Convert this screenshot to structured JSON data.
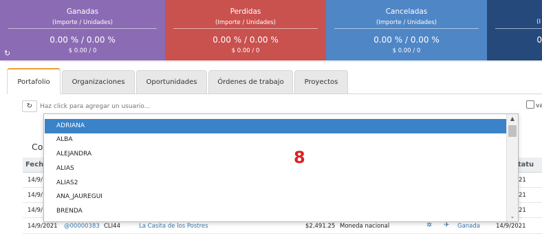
{
  "cards": [
    {
      "title": "Ganadas",
      "sub": "(Importe / Unidades)",
      "pct": "0.00 % / 0.00 %",
      "amt": "$ 0.00 / 0",
      "color": "#8b6bb4"
    },
    {
      "title": "Perdidas",
      "sub": "(Importe / Unidades)",
      "pct": "0.00 % / 0.00 %",
      "amt": "$ 0.00 / 0",
      "color": "#c9514e"
    },
    {
      "title": "Canceladas",
      "sub": "(Importe / Unidades)",
      "pct": "0.00 % / 0.00 %",
      "amt": "$ 0.00 / 0",
      "color": "#4f86c6"
    },
    {
      "title": "",
      "sub": "(I",
      "pct": "0",
      "amt": "",
      "color": "#25497b"
    }
  ],
  "tabs": [
    "Portafolio",
    "Organizaciones",
    "Oportunidades",
    "Órdenes de trabajo",
    "Proyectos"
  ],
  "active_tab": "Portafolio",
  "user_input": {
    "placeholder": "Haz click para agregar un usuario...",
    "value": ""
  },
  "checkbox_label": "va",
  "section_title": "Co",
  "table": {
    "headers": {
      "fecha": "Fech",
      "estatus": "estatu"
    },
    "rows": [
      {
        "fecha": "14/9/",
        "right": "21"
      },
      {
        "fecha": "14/9/",
        "right": "21"
      },
      {
        "fecha": "14/9/",
        "right": "21"
      },
      {
        "fecha": "14/9/2021",
        "folio": "@00000383",
        "cliente": "CLI44",
        "nombre": "La Casita de los Postres",
        "importe": "$2,491.25",
        "moneda": "Moneda nacional",
        "estado": "Ganada",
        "fecha2": "14/9/2021"
      }
    ]
  },
  "dropdown": {
    "options": [
      "ADRIANA",
      "ALBA",
      "ALEJANDRA",
      "ALIAS",
      "ALIAS2",
      "ANA_JAUREGUI",
      "BRENDA"
    ],
    "selected": "ADRIANA"
  },
  "badge": "8",
  "icons": {
    "refresh": "refresh-icon",
    "sync": "sync-icon"
  }
}
